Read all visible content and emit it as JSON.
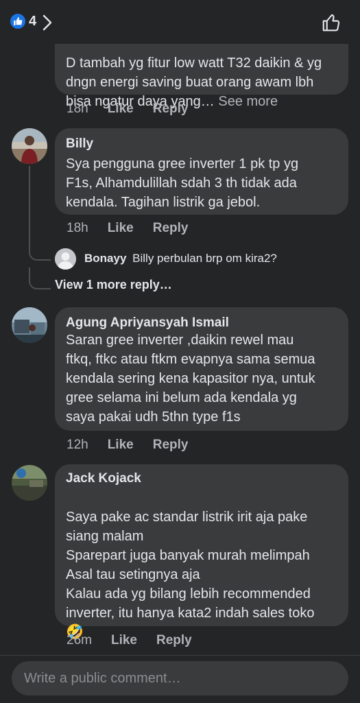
{
  "header": {
    "reaction_count": "4"
  },
  "comments": [
    {
      "text_partial": "D tambah yg fitur low watt T32 daikin & yg\ndngn energi saving buat orang awam lbh\nbisa ngatur daya yang…",
      "see_more": "See more",
      "time": "18h",
      "like": "Like",
      "reply": "Reply"
    },
    {
      "name": "Billy",
      "text": "Sya pengguna gree inverter 1 pk tp yg\nF1s, Alhamdulillah sdah 3 th tidak ada\nkendala. Tagihan listrik ga jebol.",
      "time": "18h",
      "like": "Like",
      "reply": "Reply",
      "reply_preview": {
        "name": "Bonayy",
        "text": "Billy perbulan brp om kira2?"
      },
      "view_more": "View 1 more reply…"
    },
    {
      "name": "Agung Apriyansyah Ismail",
      "text": "Saran gree inverter ,daikin rewel mau\nftkq, ftkc atau ftkm evapnya sama semua\nkendala sering kena kapasitor nya, untuk\ngree selama ini belum ada kendala yg\nsaya pakai udh 5thn type f1s",
      "time": "12h",
      "like": "Like",
      "reply": "Reply"
    },
    {
      "name": "Jack Kojack",
      "text": "Saya pake ac standar listrik irit aja pake\nsiang malam\nSparepart juga banyak murah melimpah\nAsal tau setingnya aja\nKalau ada yg bilang lebih recommended\ninverter, itu hanya kata2 indah sales toko",
      "emoji": "🤣",
      "time": "26m",
      "like": "Like",
      "reply": "Reply"
    }
  ],
  "composer": {
    "placeholder": "Write a public comment…"
  },
  "colors": {
    "background": "#242526",
    "bubble": "#3a3b3c",
    "accent": "#1b74e4",
    "muted": "#b0b3b8"
  }
}
